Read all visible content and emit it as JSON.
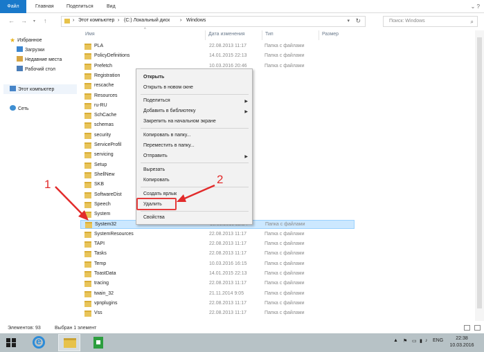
{
  "ribbon": {
    "tabs": [
      "Файл",
      "Главная",
      "Поделиться",
      "Вид"
    ]
  },
  "address": {
    "crumbs": [
      "Этот компьютер",
      "(C:) Локальный диск",
      "Windows"
    ],
    "search_placeholder": "Поиск: Windows"
  },
  "nav": {
    "favorites": "Избранное",
    "downloads": "Загрузки",
    "recent": "Недавние места",
    "desktop": "Рабочий стол",
    "this_pc": "Этот компьютер",
    "network": "Сеть"
  },
  "columns": {
    "name": "Имя",
    "date": "Дата изменения",
    "type": "Тип",
    "size": "Размер"
  },
  "files": [
    {
      "name": "PLA",
      "date": "22.08.2013 11:17",
      "type": "Папка с файлами"
    },
    {
      "name": "PolicyDefinitions",
      "date": "14.01.2015 22:13",
      "type": "Папка с файлами"
    },
    {
      "name": "Prefetch",
      "date": "10.03.2016 20:46",
      "type": "Папка с файлами"
    },
    {
      "name": "Registration",
      "date": "",
      "type": ""
    },
    {
      "name": "rescache",
      "date": "",
      "type": ""
    },
    {
      "name": "Resources",
      "date": "",
      "type": ""
    },
    {
      "name": "ru-RU",
      "date": "",
      "type": ""
    },
    {
      "name": "SchCache",
      "date": "",
      "type": ""
    },
    {
      "name": "schemas",
      "date": "",
      "type": ""
    },
    {
      "name": "security",
      "date": "",
      "type": ""
    },
    {
      "name": "ServiceProfil",
      "date": "",
      "type": ""
    },
    {
      "name": "servicing",
      "date": "",
      "type": ""
    },
    {
      "name": "Setup",
      "date": "",
      "type": ""
    },
    {
      "name": "ShellNew",
      "date": "",
      "type": ""
    },
    {
      "name": "SKB",
      "date": "",
      "type": ""
    },
    {
      "name": "SoftwareDist",
      "date": "",
      "type": ""
    },
    {
      "name": "Speech",
      "date": "",
      "type": ""
    },
    {
      "name": "System",
      "date": "",
      "type": ""
    },
    {
      "name": "System32",
      "date": "10.03.2016 22:24",
      "type": "Папка с файлами",
      "selected": true
    },
    {
      "name": "SystemResources",
      "date": "22.08.2013 11:17",
      "type": "Папка с файлами"
    },
    {
      "name": "TAPI",
      "date": "22.08.2013 11:17",
      "type": "Папка с файлами"
    },
    {
      "name": "Tasks",
      "date": "22.08.2013 11:17",
      "type": "Папка с файлами"
    },
    {
      "name": "Temp",
      "date": "10.03.2016 16:15",
      "type": "Папка с файлами"
    },
    {
      "name": "ToastData",
      "date": "14.01.2015 22:13",
      "type": "Папка с файлами"
    },
    {
      "name": "tracing",
      "date": "22.08.2013 11:17",
      "type": "Папка с файлами"
    },
    {
      "name": "twain_32",
      "date": "21.11.2014 9:05",
      "type": "Папка с файлами"
    },
    {
      "name": "vpnplugins",
      "date": "22.08.2013 11:17",
      "type": "Папка с файлами"
    },
    {
      "name": "Vss",
      "date": "22.08.2013 11:17",
      "type": "Папка с файлами"
    }
  ],
  "context_menu": {
    "open": "Открыть",
    "open_new": "Открыть в новом окне",
    "share": "Поделиться",
    "add_library": "Добавить в библиотеку",
    "pin_start": "Закрепить на начальном экране",
    "copy_to": "Копировать в папку...",
    "move_to": "Переместить в папку...",
    "send_to": "Отправить",
    "cut": "Вырезать",
    "copy": "Копировать",
    "create_shortcut": "Создать ярлык",
    "delete": "Удалить",
    "properties": "Свойства"
  },
  "annotations": {
    "one": "1",
    "two": "2"
  },
  "status": {
    "count": "Элементов: 93",
    "selected": "Выбран 1 элемент"
  },
  "taskbar": {
    "lang": "ENG",
    "time": "22:38",
    "date": "10.03.2016"
  }
}
